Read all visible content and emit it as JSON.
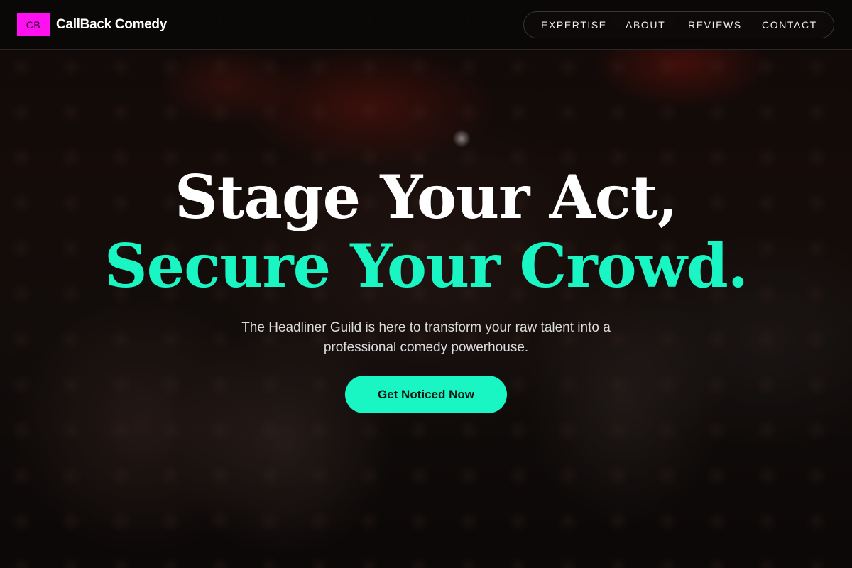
{
  "brand": {
    "mark": "CB",
    "name": "CallBack Comedy"
  },
  "nav": {
    "items": [
      {
        "label": "EXPERTISE"
      },
      {
        "label": "ABOUT"
      },
      {
        "label": "REVIEWS"
      },
      {
        "label": "CONTACT"
      }
    ]
  },
  "hero": {
    "headline_line1": "Stage Your Act,",
    "headline_line2": "Secure Your Crowd.",
    "subtitle": "The Headliner Guild is here to transform your raw talent into a professional comedy powerhouse.",
    "cta_label": "Get Noticed Now"
  },
  "colors": {
    "accent": "#1af5c4",
    "brand_mark": "#ff10f0",
    "header_bg": "#0a0808"
  }
}
